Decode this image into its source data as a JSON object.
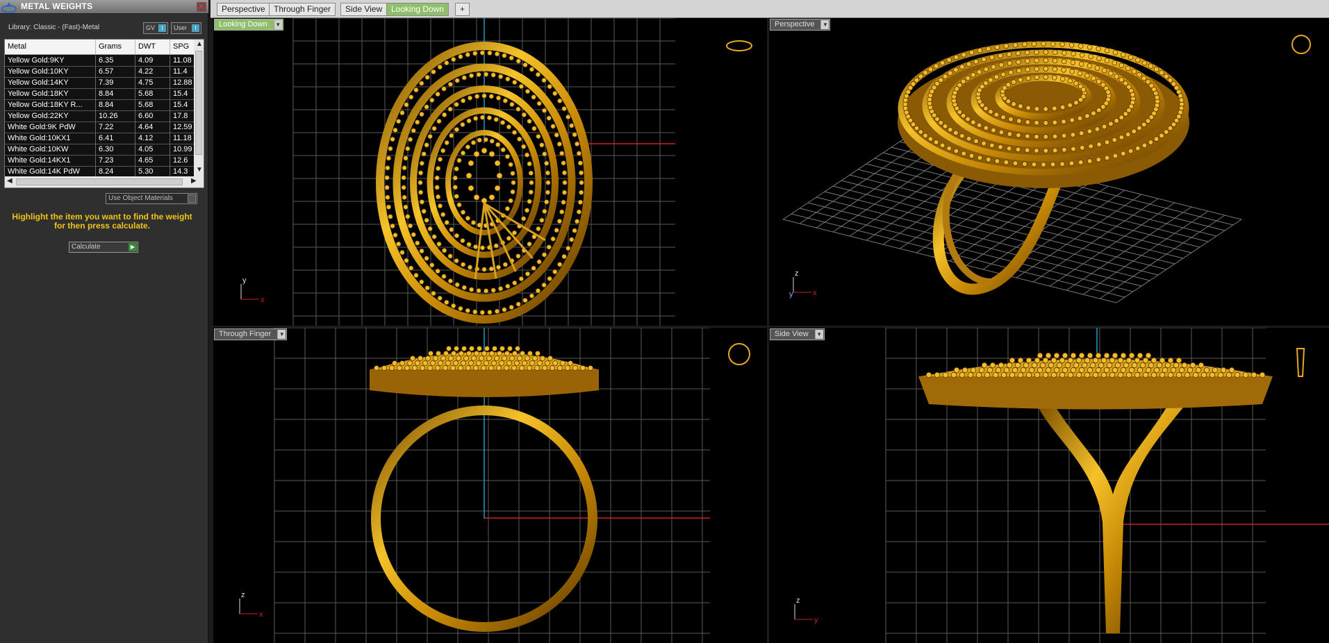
{
  "panel": {
    "title": "METAL WEIGHTS",
    "library": "Library: Classic - (Fast)-Metal",
    "toggles": [
      {
        "label": "GV",
        "state": "I"
      },
      {
        "label": "User",
        "state": "I"
      }
    ],
    "columns": [
      "Metal",
      "Grams",
      "DWT",
      "SPG"
    ],
    "rows": [
      [
        "Yellow Gold:9KY",
        "6.35",
        "4.09",
        "11.08"
      ],
      [
        "Yellow Gold:10KY",
        "6.57",
        "4.22",
        "11.4"
      ],
      [
        "Yellow Gold:14KY",
        "7.39",
        "4.75",
        "12.88"
      ],
      [
        "Yellow Gold:18KY",
        "8.84",
        "5.68",
        "15.4"
      ],
      [
        "Yellow Gold:18KY R...",
        "8.84",
        "5.68",
        "15.4"
      ],
      [
        "Yellow Gold:22KY",
        "10.26",
        "6.60",
        "17.8"
      ],
      [
        "White Gold:9K PdW",
        "7.22",
        "4.64",
        "12.59"
      ],
      [
        "White Gold:10KX1",
        "6.41",
        "4.12",
        "11.18"
      ],
      [
        "White Gold:10KW",
        "6.30",
        "4.05",
        "10.99"
      ],
      [
        "White Gold:14KX1",
        "7.23",
        "4.65",
        "12.6"
      ],
      [
        "White Gold:14K PdW",
        "8.24",
        "5.30",
        "14.3"
      ]
    ],
    "use_object_materials": "Use Object Materials",
    "instruction": "Highlight the item you want to find the weight for then press calculate.",
    "calculate": "Calculate"
  },
  "tabs": [
    "Perspective",
    "Through Finger",
    "Side View",
    "Looking Down",
    "+"
  ],
  "active_tab": "Looking Down",
  "viewports": {
    "top_left": {
      "label": "Looking Down",
      "axes": [
        "y",
        "x"
      ]
    },
    "top_right": {
      "label": "Perspective",
      "axes": [
        "z",
        "y",
        "x"
      ]
    },
    "bottom_left": {
      "label": "Through Finger",
      "axes": [
        "z",
        "x"
      ]
    },
    "bottom_right": {
      "label": "Side View",
      "axes": [
        "z",
        "y"
      ]
    }
  },
  "colors": {
    "gold": "#e0a81c",
    "grid": "#5a5a5a",
    "axis_x": "#cc2222",
    "axis_y": "#1aa0c0",
    "active_tab": "#8fbf6a",
    "instruction": "#f0c419"
  }
}
